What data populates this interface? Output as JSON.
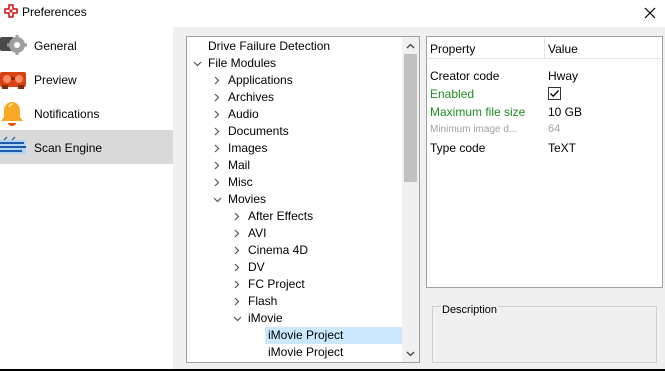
{
  "window": {
    "title": "Preferences"
  },
  "sidebar": {
    "items": [
      {
        "label": "General",
        "icon": "gear-icon",
        "selected": false
      },
      {
        "label": "Preview",
        "icon": "preview-icon",
        "selected": false
      },
      {
        "label": "Notifications",
        "icon": "bell-icon",
        "selected": false
      },
      {
        "label": "Scan Engine",
        "icon": "scan-engine-icon",
        "selected": true
      }
    ]
  },
  "tree": {
    "rows": [
      {
        "label": "Drive Failure Detection",
        "level": 0,
        "expander": "none"
      },
      {
        "label": "File Modules",
        "level": 0,
        "expander": "expanded"
      },
      {
        "label": "Applications",
        "level": 1,
        "expander": "collapsed"
      },
      {
        "label": "Archives",
        "level": 1,
        "expander": "collapsed"
      },
      {
        "label": "Audio",
        "level": 1,
        "expander": "collapsed"
      },
      {
        "label": "Documents",
        "level": 1,
        "expander": "collapsed"
      },
      {
        "label": "Images",
        "level": 1,
        "expander": "collapsed"
      },
      {
        "label": "Mail",
        "level": 1,
        "expander": "collapsed"
      },
      {
        "label": "Misc",
        "level": 1,
        "expander": "collapsed"
      },
      {
        "label": "Movies",
        "level": 1,
        "expander": "expanded"
      },
      {
        "label": "After Effects",
        "level": 2,
        "expander": "collapsed"
      },
      {
        "label": "AVI",
        "level": 2,
        "expander": "collapsed"
      },
      {
        "label": "Cinema 4D",
        "level": 2,
        "expander": "collapsed"
      },
      {
        "label": "DV",
        "level": 2,
        "expander": "collapsed"
      },
      {
        "label": "FC Project",
        "level": 2,
        "expander": "collapsed"
      },
      {
        "label": "Flash",
        "level": 2,
        "expander": "collapsed"
      },
      {
        "label": "iMovie",
        "level": 2,
        "expander": "expanded"
      },
      {
        "label": "iMovie Project",
        "level": 3,
        "expander": "none",
        "selected": true
      },
      {
        "label": "iMovie Project",
        "level": 3,
        "expander": "none"
      }
    ]
  },
  "properties": {
    "header": {
      "property": "Property",
      "value": "Value"
    },
    "rows": [
      {
        "name": "Creator code",
        "value": "Hway",
        "style": "normal"
      },
      {
        "name": "Enabled",
        "value": "",
        "checked": true,
        "style": "modified"
      },
      {
        "name": "Maximum file size",
        "value": "10 GB",
        "style": "modified"
      },
      {
        "name": "Minimum image d...",
        "value": "64",
        "style": "disabled"
      },
      {
        "name": "Type code",
        "value": "TeXT",
        "style": "normal"
      }
    ]
  },
  "description": {
    "label": "Description"
  },
  "colors": {
    "selected_sidebar": "#d9d9d9",
    "selected_tree_row": "#cce8ff",
    "modified_text": "#1f8c1f",
    "disabled_text": "#a0a0a0"
  }
}
